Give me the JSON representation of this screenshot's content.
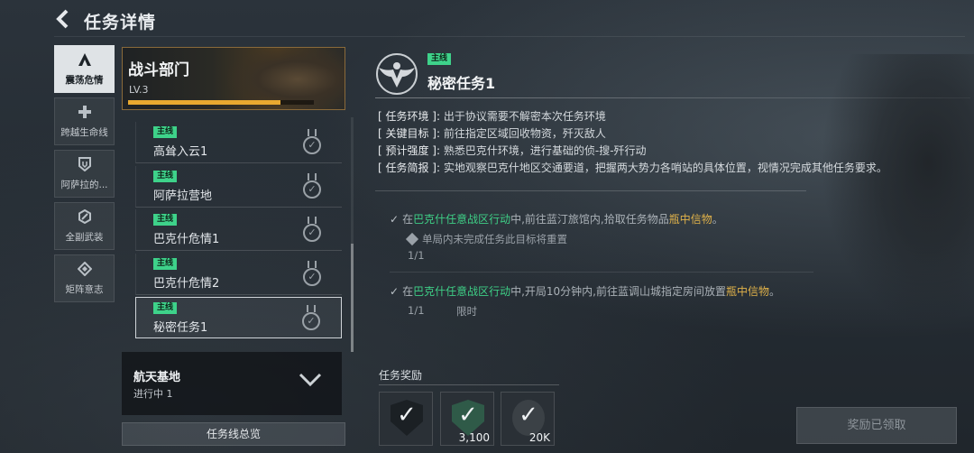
{
  "header": {
    "title": "任务详情"
  },
  "sidebar": {
    "items": [
      {
        "label": "震荡危情",
        "icon": "triangle-a-icon"
      },
      {
        "label": "跨越生命线",
        "icon": "plus-icon"
      },
      {
        "label": "阿萨拉的...",
        "icon": "shield-icon"
      },
      {
        "label": "全副武装",
        "icon": "gear-icon"
      },
      {
        "label": "矩阵意志",
        "icon": "diamond-icon"
      }
    ]
  },
  "branch": {
    "name": "战斗部门",
    "level": "LV.3",
    "progress": 0.82
  },
  "missions": [
    {
      "tag": "主线",
      "name": "高耸入云1"
    },
    {
      "tag": "主线",
      "name": "阿萨拉营地"
    },
    {
      "tag": "主线",
      "name": "巴克什危情1"
    },
    {
      "tag": "主线",
      "name": "巴克什危情2"
    },
    {
      "tag": "主线",
      "name": "秘密任务1"
    }
  ],
  "group": {
    "name": "航天基地",
    "status": "进行中 1"
  },
  "overview_label": "任务线总览",
  "detail": {
    "tag": "主线",
    "title": "秘密任务1",
    "info": [
      {
        "key": "[ 任务环境 ]:",
        "value": "出于协议需要不解密本次任务环境"
      },
      {
        "key": "[ 关键目标 ]:",
        "value": "前往指定区域回收物资，歼灭敌人"
      },
      {
        "key": "[ 预计强度 ]:",
        "value": "熟悉巴克什环境，进行基础的侦-搜-歼行动"
      },
      {
        "key": "[ 任务简报 ]:",
        "value": "实地观察巴克什地区交通要道，把握两大势力各哨站的具体位置，视情况完成其他任务要求。"
      }
    ],
    "objectives": [
      {
        "prefix": "在",
        "zone": "巴克什任意战区行动",
        "mid": "中,前往蓝汀旅馆内,拾取任务物品",
        "item": "瓶中信物",
        "end": "。",
        "note": "单局内未完成任务此目标将重置",
        "progress": "1/1",
        "limit": ""
      },
      {
        "prefix": "在",
        "zone": "巴克什任意战区行动",
        "mid": "中,开局10分钟内,前往蓝调山城指定房间放置",
        "item": "瓶中信物",
        "end": "。",
        "note": "",
        "progress": "1/1",
        "limit": "限时"
      }
    ]
  },
  "rewards": {
    "title": "任务奖励",
    "items": [
      {
        "amount": ""
      },
      {
        "amount": "3,100"
      },
      {
        "amount": "20K"
      }
    ]
  },
  "claim_label": "奖励已领取"
}
